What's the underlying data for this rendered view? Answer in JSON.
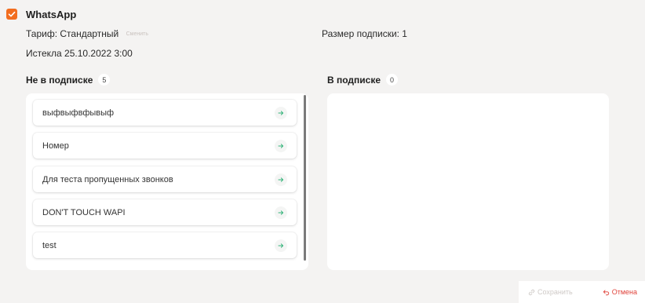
{
  "integration": {
    "name": "WhatsApp",
    "checked": true,
    "tariff_label": "Тариф: Стандартный",
    "change_label": "Сменить",
    "subscription_size": "Размер подписки: 1",
    "expired": "Истекла 25.10.2022 3:00"
  },
  "not_subscribed": {
    "title": "Не в подписке",
    "count": "5",
    "items": [
      {
        "label": "выфвыфвфывыф"
      },
      {
        "label": "Номер"
      },
      {
        "label": "Для теста пропущенных звонков"
      },
      {
        "label": "DON'T TOUCH WAPI"
      },
      {
        "label": "test"
      }
    ]
  },
  "subscribed": {
    "title": "В подписке",
    "count": "0",
    "items": []
  },
  "footer": {
    "save_label": "Сохранить",
    "cancel_label": "Отмена"
  },
  "colors": {
    "accent": "#f26d1f",
    "arrow": "#34b37a",
    "cancel": "#e0443c",
    "disabled": "#cfcac7"
  },
  "icons": {
    "checkbox": "checkmark-icon",
    "item_action": "arrow-right-icon",
    "save": "link-icon",
    "cancel": "undo-arrow-icon"
  }
}
